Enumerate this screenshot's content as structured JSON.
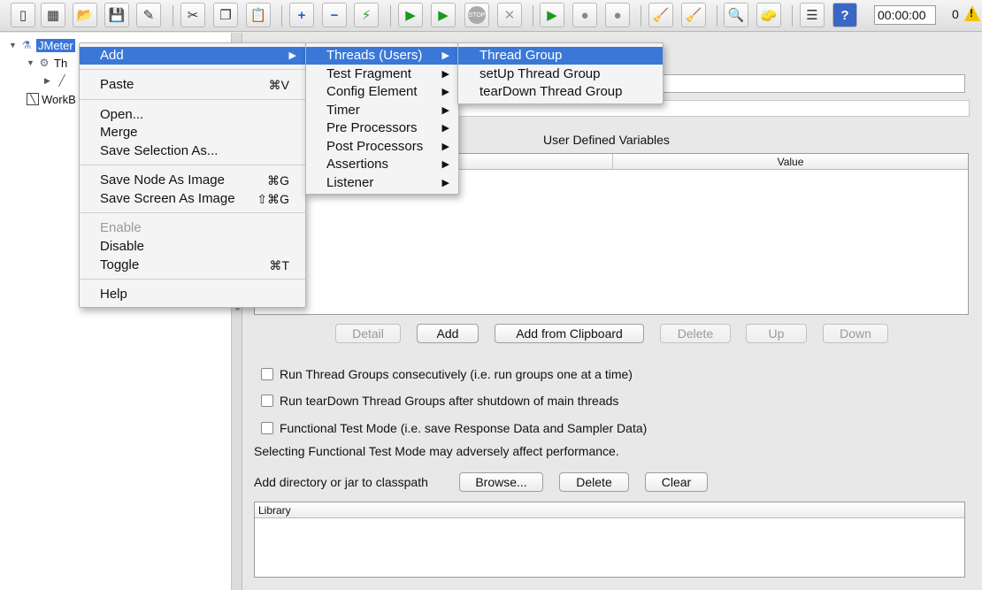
{
  "toolbar": {
    "timer": "00:00:00",
    "active_count": "0",
    "buttons": [
      {
        "name": "new-icon",
        "glyph": "▯"
      },
      {
        "name": "templates-icon",
        "glyph": "▦"
      },
      {
        "name": "open-icon",
        "glyph": "📂"
      },
      {
        "name": "save-icon",
        "glyph": "💾"
      },
      {
        "name": "save-as-icon",
        "glyph": "✎"
      },
      {
        "name": "cut-icon",
        "glyph": "✂"
      },
      {
        "name": "copy-icon",
        "glyph": "❐"
      },
      {
        "name": "paste-icon",
        "glyph": "📋"
      },
      {
        "name": "expand-all-icon",
        "glyph": "+"
      },
      {
        "name": "collapse-all-icon",
        "glyph": "−"
      },
      {
        "name": "toggle-icon",
        "glyph": "⚡"
      },
      {
        "name": "start-icon",
        "glyph": "▶"
      },
      {
        "name": "start-no-pauses-icon",
        "glyph": "▶"
      },
      {
        "name": "stop-icon",
        "glyph": "STOP"
      },
      {
        "name": "shutdown-icon",
        "glyph": "✕"
      },
      {
        "name": "remote-start-icon",
        "glyph": "▶"
      },
      {
        "name": "remote-stop-icon",
        "glyph": "●"
      },
      {
        "name": "remote-shutdown-icon",
        "glyph": "●"
      },
      {
        "name": "clear-icon",
        "glyph": "🧹"
      },
      {
        "name": "clear-all-icon",
        "glyph": "🧹"
      },
      {
        "name": "search-icon",
        "glyph": "🔍"
      },
      {
        "name": "reset-search-icon",
        "glyph": "🧽"
      },
      {
        "name": "function-helper-icon",
        "glyph": "☰"
      },
      {
        "name": "help-icon",
        "glyph": "?"
      }
    ]
  },
  "tree": {
    "root": "JMeter",
    "child1": "Th",
    "workbench": "WorkB"
  },
  "menu_main": {
    "add": "Add",
    "paste": "Paste",
    "paste_sc": "⌘V",
    "open": "Open...",
    "merge": "Merge",
    "save_selection": "Save Selection As...",
    "save_node_image": "Save Node As Image",
    "save_node_image_sc": "⌘G",
    "save_screen_image": "Save Screen As Image",
    "save_screen_image_sc": "⇧⌘G",
    "enable": "Enable",
    "disable": "Disable",
    "toggle": "Toggle",
    "toggle_sc": "⌘T",
    "help": "Help"
  },
  "menu_add": {
    "items": [
      "Threads (Users)",
      "Test Fragment",
      "Config Element",
      "Timer",
      "Pre Processors",
      "Post Processors",
      "Assertions",
      "Listener"
    ]
  },
  "menu_threads": {
    "items": [
      "Thread Group",
      "setUp Thread Group",
      "tearDown Thread Group"
    ]
  },
  "panel": {
    "udv_title": "User Defined Variables",
    "col_value": "Value",
    "btn_detail": "Detail",
    "btn_add": "Add",
    "btn_add_clipboard": "Add from Clipboard",
    "btn_delete": "Delete",
    "btn_up": "Up",
    "btn_down": "Down",
    "chk_consecutive": "Run Thread Groups consecutively (i.e. run groups one at a time)",
    "chk_teardown": "Run tearDown Thread Groups after shutdown of main threads",
    "chk_functional": "Functional Test Mode (i.e. save Response Data and Sampler Data)",
    "functional_note": "Selecting Functional Test Mode may adversely affect performance.",
    "classpath_label": "Add directory or jar to classpath",
    "btn_browse": "Browse...",
    "btn_cp_delete": "Delete",
    "btn_clear": "Clear",
    "library_header": "Library"
  }
}
